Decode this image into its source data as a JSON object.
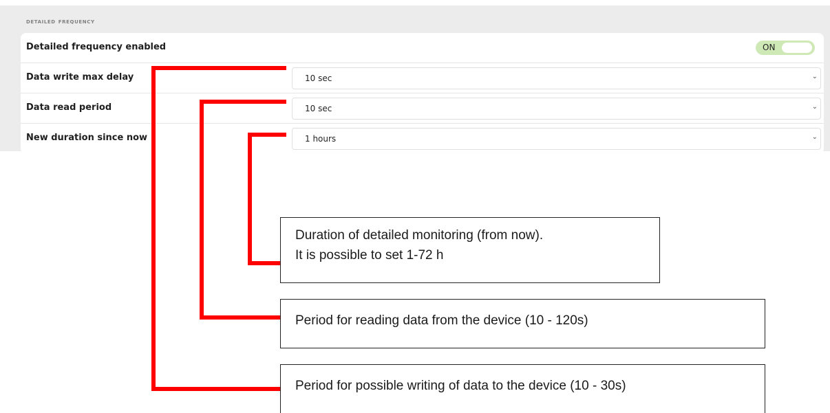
{
  "section": {
    "title": "Detailed frequency"
  },
  "rows": [
    {
      "label": "Detailed frequency enabled",
      "toggle_text": "ON"
    },
    {
      "label": "Data write max delay",
      "value": "10 sec"
    },
    {
      "label": "Data read period",
      "value": "10 sec"
    },
    {
      "label": "New duration since now",
      "value": "1 hours"
    }
  ],
  "chevron_icon": "chevron-down-icon",
  "annotations": {
    "duration_line1": "Duration of detailed monitoring (from now).",
    "duration_line2": "It is possible to set 1-72 h",
    "read_period": "Period for reading data from the device (10 - 120s)",
    "write_period": "Period for possible writing of data to the device (10 - 30s)"
  },
  "colors": {
    "accent_line": "#ff0000",
    "toggle_on": "#cfe9b6"
  }
}
